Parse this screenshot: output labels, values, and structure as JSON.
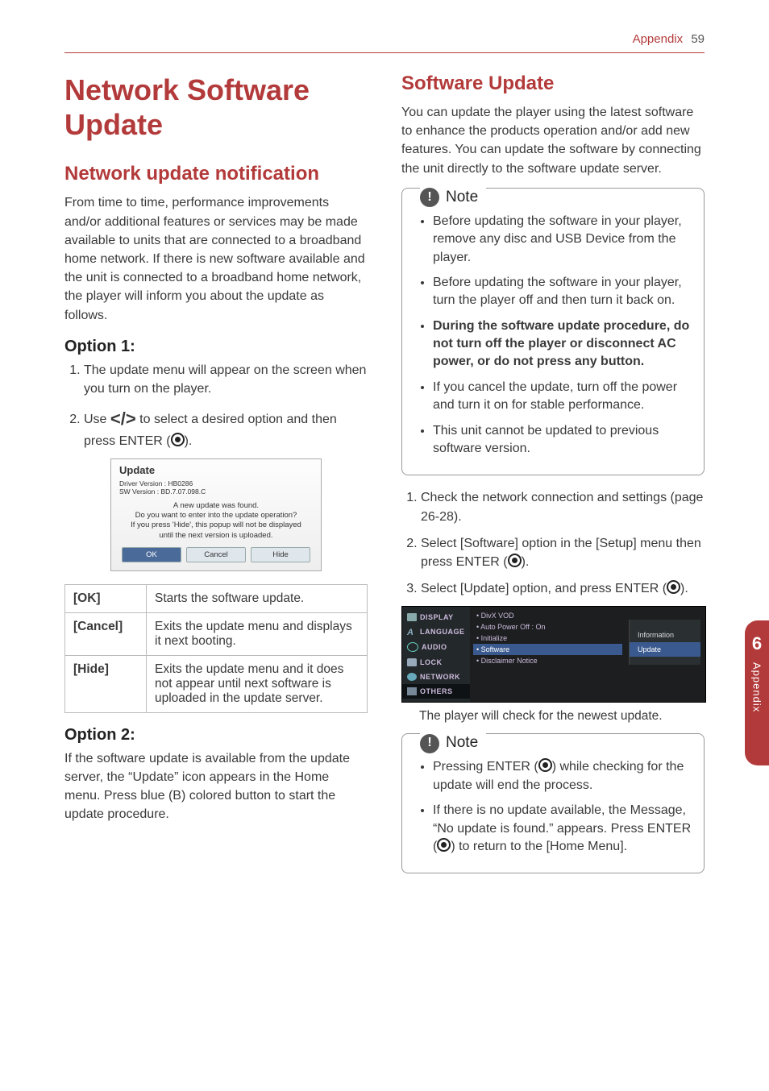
{
  "header": {
    "section": "Appendix",
    "page": "59"
  },
  "sideTab": {
    "num": "6",
    "label": "Appendix"
  },
  "left": {
    "h1": "Network Software Update",
    "h2": "Network update notification",
    "intro": "From time to time, performance improvements and/or additional features or services may be made available to units that are connected to a broadband home network. If there is new software available and the unit is connected to a broadband home network, the player will inform you about the update as follows.",
    "opt1": {
      "title": "Option 1:",
      "steps": [
        "The update menu will appear on the screen when you turn on the player.",
        "Use          to select a desired option and then press ENTER (   )."
      ],
      "step2_pre": "Use ",
      "step2_post": " to select a desired option and then press ENTER (",
      "step2_end": ")."
    },
    "dialog": {
      "title": "Update",
      "meta1": "Driver Version : HB0286",
      "meta2": "SW Version : BD.7.07.098.C",
      "msg1": "A new update was found.",
      "msg2": "Do you want to enter into the update operation?",
      "msg3": "If you press 'Hide', this popup will not be displayed",
      "msg4": "until the next version is uploaded.",
      "btns": [
        "OK",
        "Cancel",
        "Hide"
      ]
    },
    "table": [
      {
        "k": "[OK]",
        "v": "Starts the software update."
      },
      {
        "k": "[Cancel]",
        "v": "Exits the update menu and displays it next booting."
      },
      {
        "k": "[Hide]",
        "v": "Exits the update menu and it does not appear until next software is uploaded in the update server."
      }
    ],
    "opt2": {
      "title": "Option 2:",
      "body": "If the software update is available from the update server, the “Update” icon appears in the Home menu. Press blue (B) colored button to start the update procedure."
    }
  },
  "right": {
    "h2": "Software Update",
    "intro": "You can update the player using the latest software to enhance the products operation and/or add new features. You can update the software by connecting the unit directly to the software update server.",
    "note1": {
      "label": "Note",
      "items": [
        "Before updating the software in your player, remove any disc and USB Device from the player.",
        "Before updating the software in your player, turn the player off and then turn it back on.",
        "During the software update procedure, do not turn off the player or disconnect AC power, or do not press any button.",
        "If you cancel the update, turn off the power and turn it on for stable performance.",
        "This unit cannot be updated to previous software version."
      ]
    },
    "steps": {
      "s1": "Check the network connection and settings (page 26-28).",
      "s2_pre": "Select [Software] option in the [Setup] menu then press ENTER (",
      "s2_end": ").",
      "s3_pre": "Select [Update] option, and press ENTER (",
      "s3_end": ")."
    },
    "menu": {
      "side": [
        "DISPLAY",
        "LANGUAGE",
        "AUDIO",
        "LOCK",
        "NETWORK",
        "OTHERS"
      ],
      "mid": [
        "• DivX VOD",
        "• Auto Power Off             : On",
        "• Initialize",
        "• Software",
        "• Disclaimer Notice"
      ],
      "pop": [
        "Information",
        "Update"
      ]
    },
    "caption": "The player will check for the newest update.",
    "note2": {
      "label": "Note",
      "i1_pre": "Pressing ENTER (",
      "i1_post": ") while checking for the update will end the process.",
      "i2_pre": "If there is no update available, the Message, “No update is found.” appears. Press ENTER (",
      "i2_post": ") to return to the [Home Menu]."
    }
  }
}
